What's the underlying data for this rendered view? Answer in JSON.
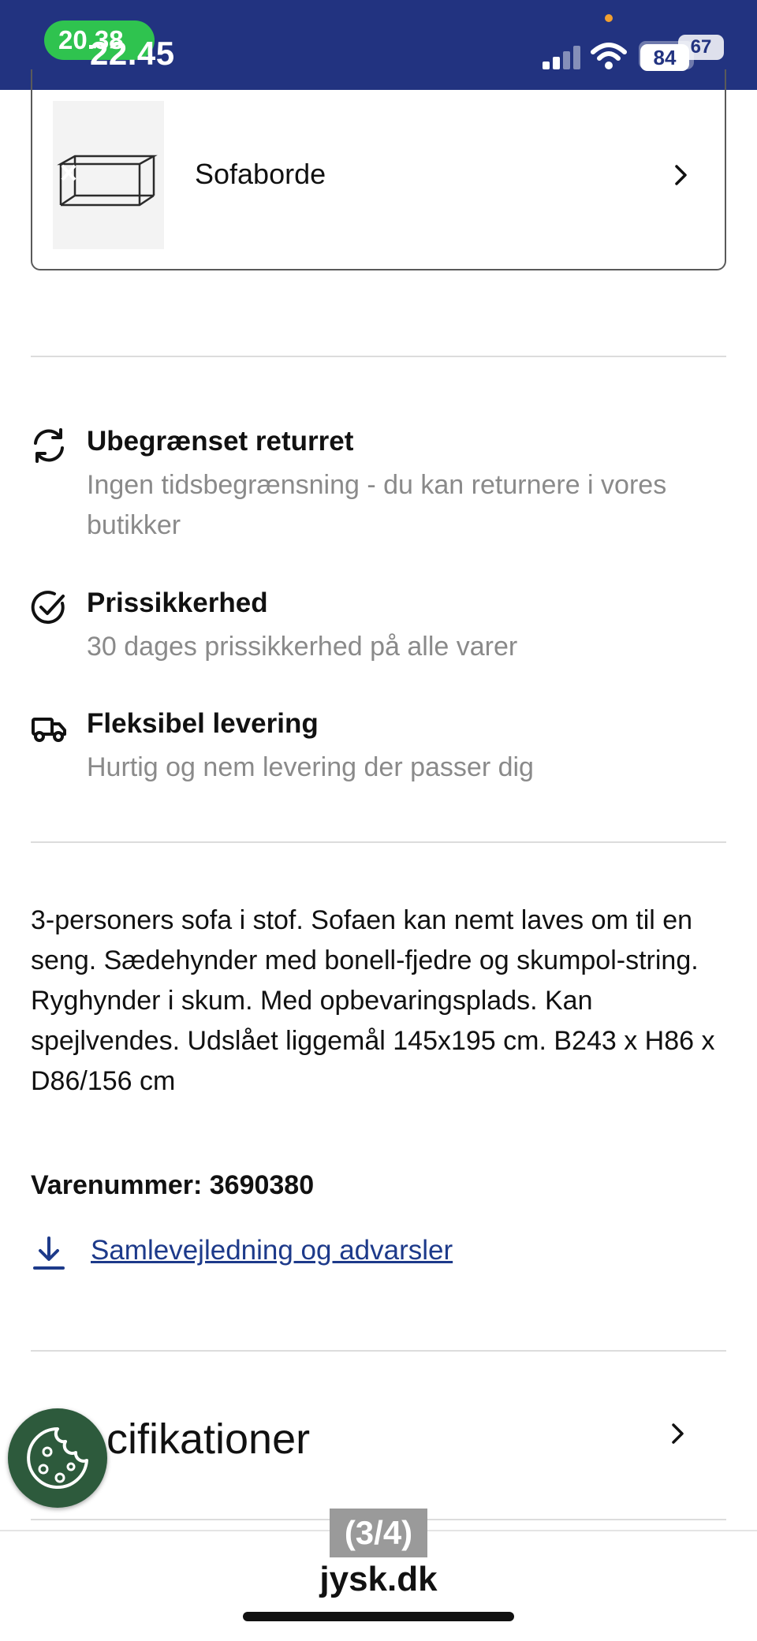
{
  "status_bar": {
    "pill_time": "20.38",
    "time": "22.45",
    "battery_front": "84",
    "battery_back": "67"
  },
  "category_card": {
    "label": "Sofaborde"
  },
  "features": [
    {
      "title": "Ubegrænset returret",
      "description": "Ingen tidsbegrænsning - du kan returnere i vores butikker",
      "icon": "refresh-icon"
    },
    {
      "title": "Prissikkerhed",
      "description": "30 dages prissikkerhed på alle varer",
      "icon": "check-circle-icon"
    },
    {
      "title": "Fleksibel levering",
      "description": "Hurtig og nem levering der passer dig",
      "icon": "truck-icon"
    }
  ],
  "product": {
    "description": "3-personers sofa i stof. Sofaen kan nemt laves om til en seng. Sædehynder med bonell-fjedre og skumpol-string. Ryghynder i skum. Med opbevaringsplads. Kan spejlvendes. Udslået liggemål 145x195 cm. B243 x H86 x D86/156 cm",
    "item_number_label": "Varenummer: 3690380"
  },
  "download": {
    "link_text": "Samlevejledning og advarsler"
  },
  "specifications": {
    "label": "cifikationer"
  },
  "overlay": {
    "counter": "(3/4)"
  },
  "browser": {
    "url": "jysk.dk"
  },
  "colors": {
    "brand_blue": "#223380",
    "link_blue": "#1d3a8a",
    "cookie_green": "#2d5a3c",
    "status_green": "#2fc34f"
  }
}
